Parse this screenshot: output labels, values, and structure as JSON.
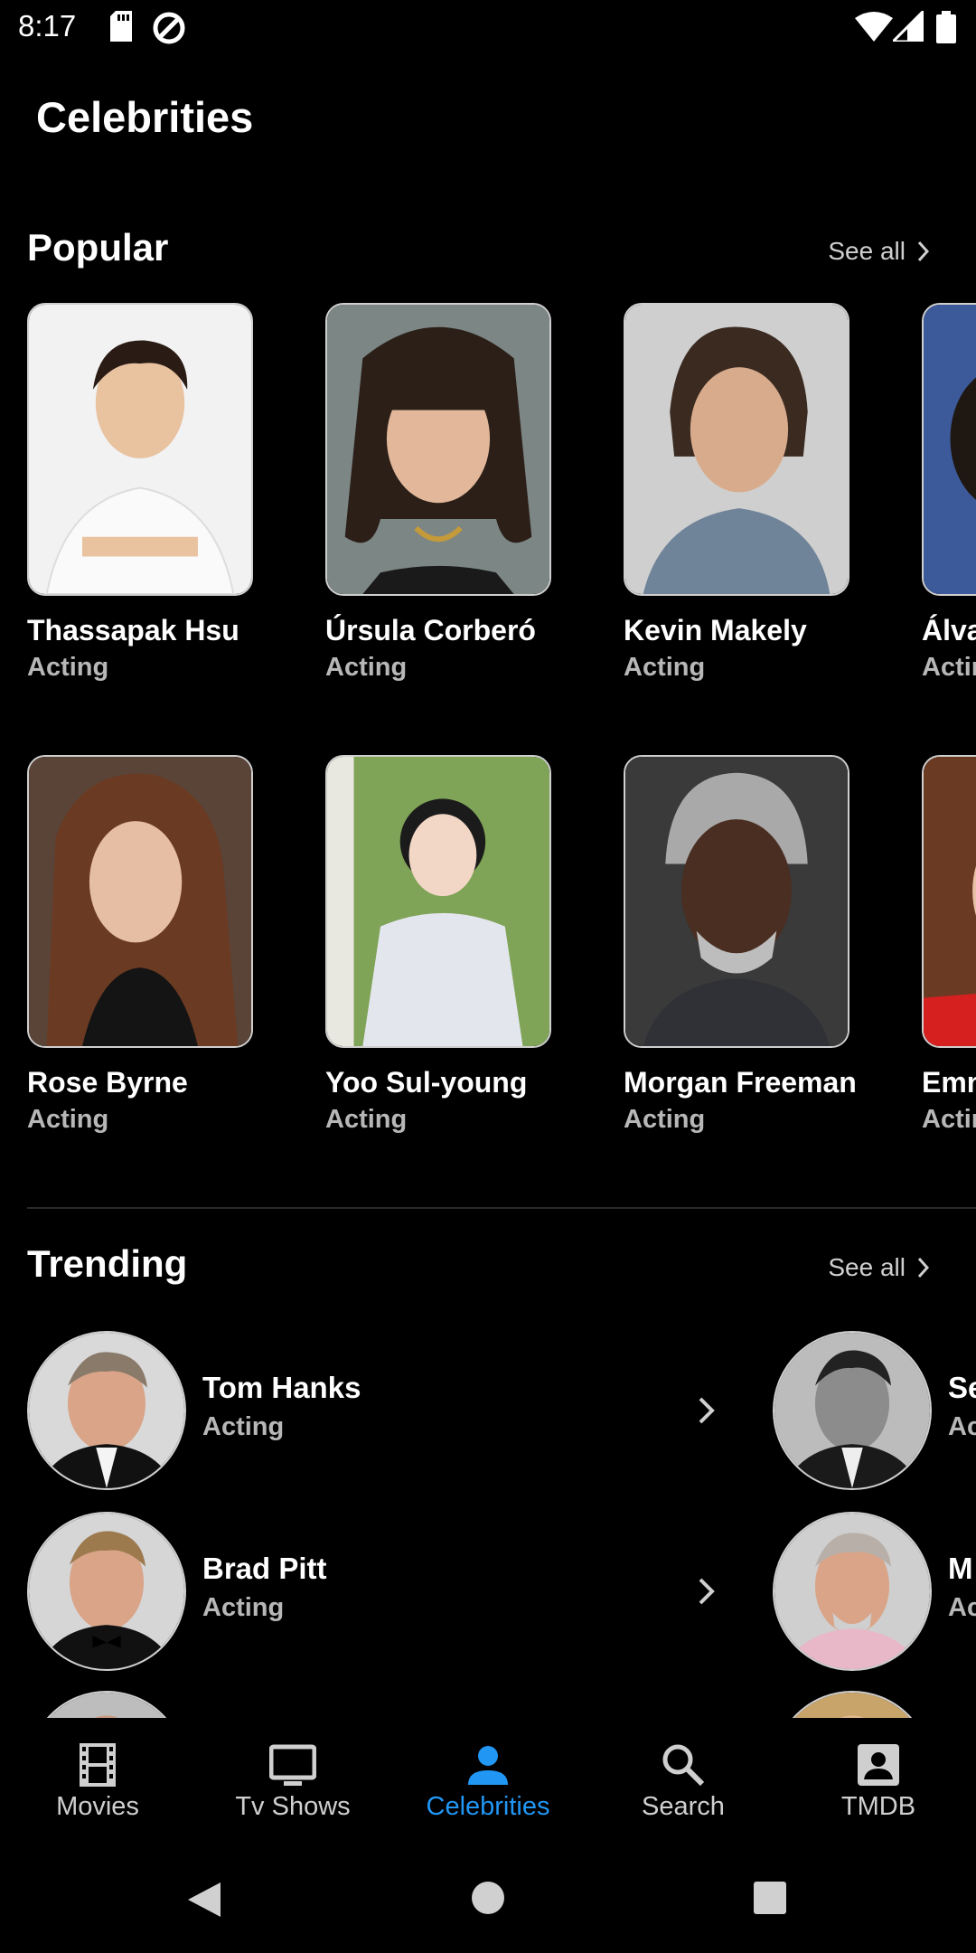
{
  "status": {
    "time": "8:17"
  },
  "page": {
    "title": "Celebrities"
  },
  "popular": {
    "title": "Popular",
    "see_all": "See all",
    "row1": [
      {
        "name": "Thassapak Hsu",
        "role": "Acting"
      },
      {
        "name": "Úrsula Corberó",
        "role": "Acting"
      },
      {
        "name": "Kevin Makely",
        "role": "Acting"
      },
      {
        "name": "Álva",
        "role": "Actir"
      }
    ],
    "row2": [
      {
        "name": "Rose Byrne",
        "role": "Acting"
      },
      {
        "name": "Yoo Sul-young",
        "role": "Acting"
      },
      {
        "name": "Morgan Freeman",
        "role": "Acting"
      },
      {
        "name": "Emn",
        "role": "Actir"
      }
    ]
  },
  "trending": {
    "title": "Trending",
    "see_all": "See all",
    "items": [
      {
        "name": "Tom Hanks",
        "role": "Acting"
      },
      {
        "name": "Brad Pitt",
        "role": "Acting"
      },
      {
        "name": "Se",
        "role": "Ac"
      },
      {
        "name": "M",
        "role": "Ac"
      }
    ]
  },
  "nav": {
    "items": [
      {
        "label": "Movies",
        "icon": "film-icon"
      },
      {
        "label": "Tv Shows",
        "icon": "tv-icon"
      },
      {
        "label": "Celebrities",
        "icon": "person-icon"
      },
      {
        "label": "Search",
        "icon": "search-icon"
      },
      {
        "label": "TMDB",
        "icon": "account-box-icon"
      }
    ],
    "active_index": 2
  },
  "colors": {
    "accent": "#2196f3",
    "background": "#000000",
    "secondary_text": "#b7b7b7"
  }
}
